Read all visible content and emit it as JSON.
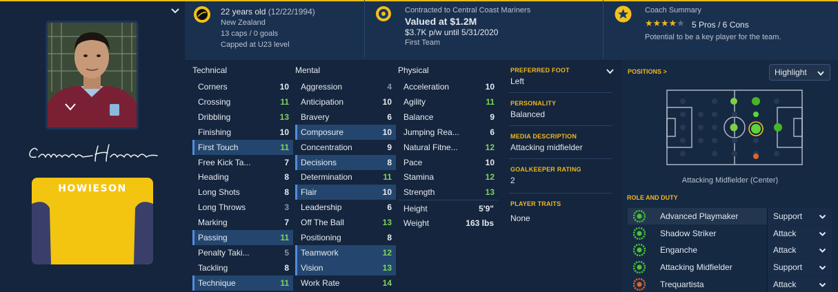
{
  "header": {
    "age_text": "22 years old",
    "dob": "(12/22/1994)",
    "nation": "New Zealand",
    "caps": "13 caps / 0 goals",
    "capped_level": "Capped at U23 level",
    "contract_text": "Contracted to Central Coast Mariners",
    "value": "Valued at $1.2M",
    "wage": "$3.7K p/w until 5/31/2020",
    "squad_status": "First Team",
    "coach_title": "Coach Summary",
    "stars": 4,
    "max_stars": 5,
    "pros_cons": "5 Pros / 6 Cons",
    "potential": "Potential to be a key player for the team."
  },
  "player": {
    "kit_name": "HOWIESON",
    "signature_icon": "signature-image"
  },
  "columns": {
    "technical": "Technical",
    "mental": "Mental",
    "physical": "Physical"
  },
  "technical": [
    {
      "name": "Corners",
      "value": "10",
      "color": "#e6ebf1",
      "hl": 0
    },
    {
      "name": "Crossing",
      "value": "11",
      "color": "#7fd35c",
      "hl": 0
    },
    {
      "name": "Dribbling",
      "value": "13",
      "color": "#7fd35c",
      "hl": 0
    },
    {
      "name": "Finishing",
      "value": "10",
      "color": "#e6ebf1",
      "hl": 0
    },
    {
      "name": "First Touch",
      "value": "11",
      "color": "#7fd35c",
      "hl": 1
    },
    {
      "name": "Free Kick Ta...",
      "value": "7",
      "color": "#e6ebf1",
      "hl": 0
    },
    {
      "name": "Heading",
      "value": "8",
      "color": "#e6ebf1",
      "hl": 0
    },
    {
      "name": "Long Shots",
      "value": "8",
      "color": "#e6ebf1",
      "hl": 0
    },
    {
      "name": "Long Throws",
      "value": "3",
      "color": "#8a96a6",
      "hl": 0
    },
    {
      "name": "Marking",
      "value": "7",
      "color": "#e6ebf1",
      "hl": 0
    },
    {
      "name": "Passing",
      "value": "11",
      "color": "#7fd35c",
      "hl": 1
    },
    {
      "name": "Penalty Taki...",
      "value": "5",
      "color": "#8a96a6",
      "hl": 0
    },
    {
      "name": "Tackling",
      "value": "8",
      "color": "#e6ebf1",
      "hl": 0
    },
    {
      "name": "Technique",
      "value": "11",
      "color": "#7fd35c",
      "hl": 1
    }
  ],
  "mental": [
    {
      "name": "Aggression",
      "value": "4",
      "color": "#8a96a6",
      "hl": 0
    },
    {
      "name": "Anticipation",
      "value": "10",
      "color": "#e6ebf1",
      "hl": 0
    },
    {
      "name": "Bravery",
      "value": "6",
      "color": "#e6ebf1",
      "hl": 0
    },
    {
      "name": "Composure",
      "value": "10",
      "color": "#e6ebf1",
      "hl": 1
    },
    {
      "name": "Concentration",
      "value": "9",
      "color": "#e6ebf1",
      "hl": 0
    },
    {
      "name": "Decisions",
      "value": "8",
      "color": "#e6ebf1",
      "hl": 1
    },
    {
      "name": "Determination",
      "value": "11",
      "color": "#7fd35c",
      "hl": 0
    },
    {
      "name": "Flair",
      "value": "10",
      "color": "#e6ebf1",
      "hl": 1
    },
    {
      "name": "Leadership",
      "value": "6",
      "color": "#e6ebf1",
      "hl": 0
    },
    {
      "name": "Off The Ball",
      "value": "13",
      "color": "#7fd35c",
      "hl": 0
    },
    {
      "name": "Positioning",
      "value": "8",
      "color": "#e6ebf1",
      "hl": 0
    },
    {
      "name": "Teamwork",
      "value": "12",
      "color": "#7fd35c",
      "hl": 1
    },
    {
      "name": "Vision",
      "value": "13",
      "color": "#7fd35c",
      "hl": 1
    },
    {
      "name": "Work Rate",
      "value": "14",
      "color": "#7fd35c",
      "hl": 0
    }
  ],
  "physical": [
    {
      "name": "Acceleration",
      "value": "10",
      "color": "#e6ebf1",
      "hl": 0
    },
    {
      "name": "Agility",
      "value": "11",
      "color": "#7fd35c",
      "hl": 0
    },
    {
      "name": "Balance",
      "value": "9",
      "color": "#e6ebf1",
      "hl": 0
    },
    {
      "name": "Jumping Rea...",
      "value": "6",
      "color": "#e6ebf1",
      "hl": 0
    },
    {
      "name": "Natural Fitne...",
      "value": "12",
      "color": "#7fd35c",
      "hl": 0
    },
    {
      "name": "Pace",
      "value": "10",
      "color": "#e6ebf1",
      "hl": 0
    },
    {
      "name": "Stamina",
      "value": "12",
      "color": "#7fd35c",
      "hl": 0
    },
    {
      "name": "Strength",
      "value": "13",
      "color": "#7fd35c",
      "hl": 0
    }
  ],
  "body": {
    "height_label": "Height",
    "height": "5'9\"",
    "weight_label": "Weight",
    "weight": "163 lbs"
  },
  "info": {
    "foot_label": "PREFERRED FOOT",
    "foot": "Left",
    "personality_label": "PERSONALITY",
    "personality": "Balanced",
    "media_label": "MEDIA DESCRIPTION",
    "media": "Attacking midfielder",
    "gk_label": "GOALKEEPER RATING",
    "gk": "2",
    "traits_label": "PLAYER TRAITS",
    "traits": "None"
  },
  "positions": {
    "title": "POSITIONS >",
    "highlight": "Highlight",
    "caption": "Attacking Midfielder (Center)"
  },
  "roles": {
    "title": "ROLE AND DUTY",
    "items": [
      {
        "name": "Advanced Playmaker",
        "duty": "Support",
        "icon_color": "#47c334"
      },
      {
        "name": "Shadow Striker",
        "duty": "Attack",
        "icon_color": "#47c334"
      },
      {
        "name": "Enganche",
        "duty": "Attack",
        "icon_color": "#47c334"
      },
      {
        "name": "Attacking Midfielder",
        "duty": "Support",
        "icon_color": "#47c334"
      },
      {
        "name": "Trequartista",
        "duty": "Attack",
        "icon_color": "#e0642a"
      }
    ]
  },
  "colors": {
    "accent": "#f0b81e",
    "good": "#7fd35c",
    "poor": "#8a96a6",
    "background": "#172a44"
  }
}
